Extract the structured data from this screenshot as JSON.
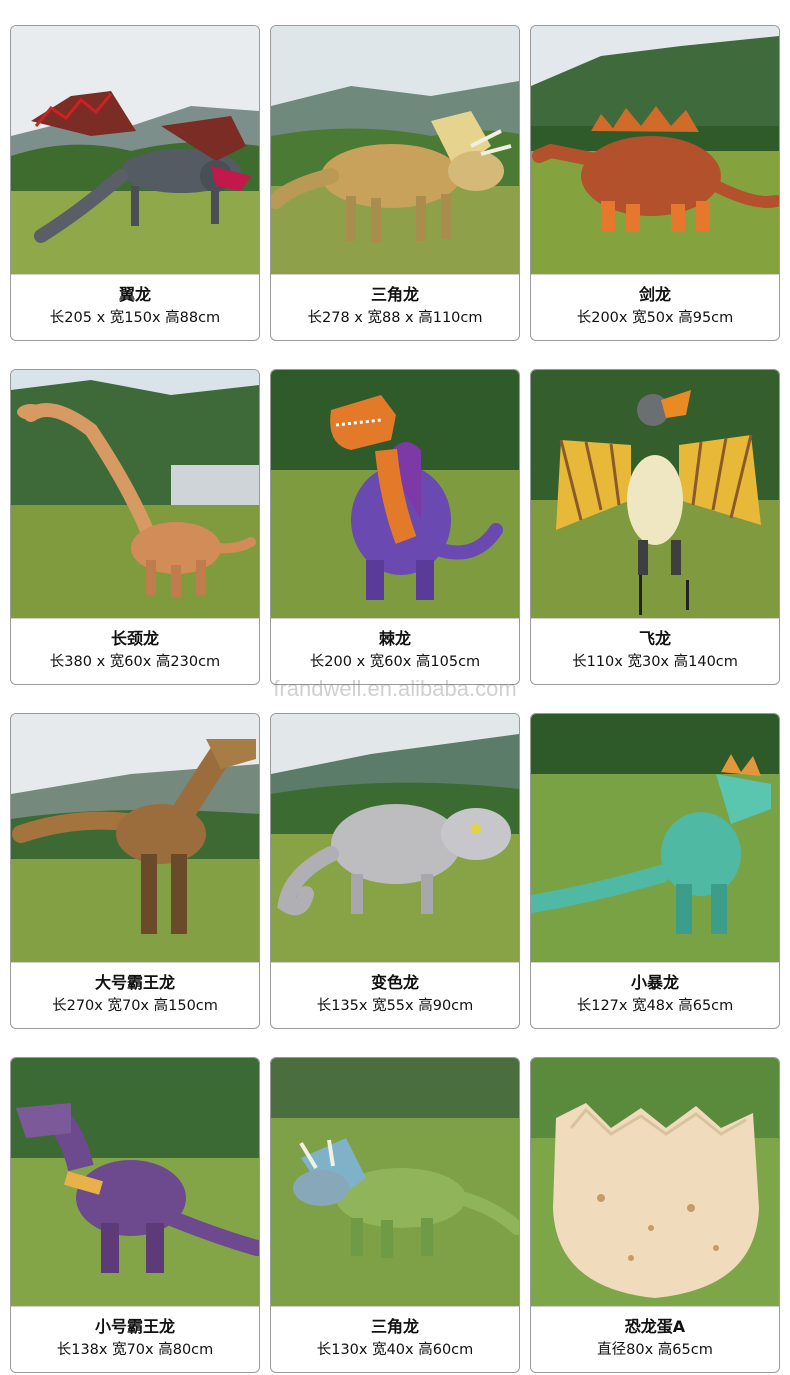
{
  "watermark": "frandwell.en.alibaba.com",
  "products": [
    {
      "name": "翼龙",
      "dims": "长205 x 宽150x 高88cm",
      "icon": "winged-dragon"
    },
    {
      "name": "三角龙",
      "dims": "长278 x 宽88 x 高110cm",
      "icon": "triceratops"
    },
    {
      "name": "剑龙",
      "dims": "长200x 宽50x 高95cm",
      "icon": "stegosaurus"
    },
    {
      "name": "长颈龙",
      "dims": "长380 x 宽60x 高230cm",
      "icon": "brachiosaurus"
    },
    {
      "name": "棘龙",
      "dims": "长200 x 宽60x 高105cm",
      "icon": "spinosaurus"
    },
    {
      "name": "飞龙",
      "dims": "长110x 宽30x 高140cm",
      "icon": "pterosaur"
    },
    {
      "name": "大号霸王龙",
      "dims": "长270x 宽70x 高150cm",
      "icon": "t-rex-large"
    },
    {
      "name": "变色龙",
      "dims": "长135x 宽55x 高90cm",
      "icon": "chameleon-dino"
    },
    {
      "name": "小暴龙",
      "dims": "长127x 宽48x 高65cm",
      "icon": "small-tyrannosaur"
    },
    {
      "name": "小号霸王龙",
      "dims": "长138x 宽70x 高80cm",
      "icon": "t-rex-small"
    },
    {
      "name": "三角龙",
      "dims": "长130x 宽40x 高60cm",
      "icon": "triceratops-small"
    },
    {
      "name": "恐龙蛋A",
      "dims": "直径80x 高65cm",
      "icon": "dinosaur-egg"
    }
  ]
}
